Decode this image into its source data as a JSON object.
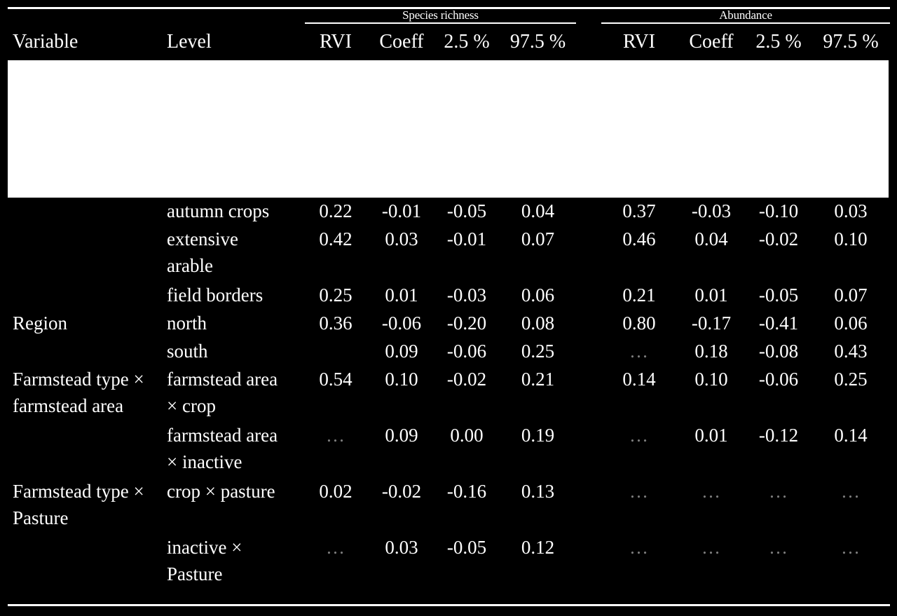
{
  "table": {
    "group_headers": [
      {
        "label": "Species richness",
        "name": "species-richness"
      },
      {
        "label": "Abundance",
        "name": "abundance"
      }
    ],
    "columns": {
      "variable": "Variable",
      "level": "Level",
      "species": {
        "rvi": "RVI",
        "coeff": "Coeff",
        "lower": "2.5 %",
        "upper": "97.5 %"
      },
      "abundance": {
        "rvi": "RVI",
        "coeff": "Coeff",
        "lower": "2.5 %",
        "upper": "97.5 %"
      }
    },
    "ellipsis": "…",
    "rows": [
      {
        "variable": "",
        "level": "autumn crops",
        "s_rvi": "0.22",
        "s_coeff": "-0.01",
        "s_lo": "-0.05",
        "s_hi": "0.04",
        "a_rvi": "0.37",
        "a_coeff": "-0.03",
        "a_lo": "-0.10",
        "a_hi": "0.03"
      },
      {
        "variable": "",
        "level": "extensive\narable",
        "s_rvi": "0.42",
        "s_coeff": "0.03",
        "s_lo": "-0.01",
        "s_hi": "0.07",
        "a_rvi": "0.46",
        "a_coeff": "0.04",
        "a_lo": "-0.02",
        "a_hi": "0.10"
      },
      {
        "variable": "",
        "level": "field borders",
        "s_rvi": "0.25",
        "s_coeff": "0.01",
        "s_lo": "-0.03",
        "s_hi": "0.06",
        "a_rvi": "0.21",
        "a_coeff": "0.01",
        "a_lo": "-0.05",
        "a_hi": "0.07"
      },
      {
        "variable": "Region",
        "level": "north",
        "s_rvi": "0.36",
        "s_coeff": "-0.06",
        "s_lo": "-0.20",
        "s_hi": "0.08",
        "a_rvi": "0.80",
        "a_coeff": "-0.17",
        "a_lo": "-0.41",
        "a_hi": "0.06"
      },
      {
        "variable": "",
        "level": "south",
        "s_rvi": "",
        "s_coeff": "0.09",
        "s_lo": "-0.06",
        "s_hi": "0.25",
        "a_rvi": "…",
        "a_coeff": "0.18",
        "a_lo": "-0.08",
        "a_hi": "0.43"
      },
      {
        "variable": "Farmstead type ×\nfarmstead area",
        "level": "farmstead area\n× crop",
        "s_rvi": "0.54",
        "s_coeff": "0.10",
        "s_lo": "-0.02",
        "s_hi": "0.21",
        "a_rvi": "0.14",
        "a_coeff": "0.10",
        "a_lo": "-0.06",
        "a_hi": "0.25"
      },
      {
        "variable": "",
        "level": "farmstead area\n× inactive",
        "s_rvi": "…",
        "s_coeff": "0.09",
        "s_lo": "0.00",
        "s_hi": "0.19",
        "a_rvi": "…",
        "a_coeff": "0.01",
        "a_lo": "-0.12",
        "a_hi": "0.14"
      },
      {
        "variable": "Farmstead type ×\nPasture",
        "level": "crop × pasture",
        "s_rvi": "0.02",
        "s_coeff": "-0.02",
        "s_lo": "-0.16",
        "s_hi": "0.13",
        "a_rvi": "…",
        "a_coeff": "…",
        "a_lo": "…",
        "a_hi": "…"
      },
      {
        "variable": "",
        "level": "inactive ×\nPasture",
        "s_rvi": "…",
        "s_coeff": "0.03",
        "s_lo": "-0.05",
        "s_hi": "0.12",
        "a_rvi": "…",
        "a_coeff": "…",
        "a_lo": "…",
        "a_hi": "…"
      }
    ]
  }
}
